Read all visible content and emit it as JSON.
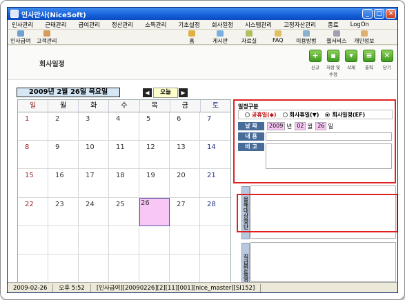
{
  "window": {
    "title": "인사만사(NiceSoft)"
  },
  "menu": [
    "인사관리",
    "근태관리",
    "급여관리",
    "정산관리",
    "소득관리",
    "기초설정",
    "회사일정",
    "시스템관리",
    "고정자산관리",
    "종료",
    "LogOn"
  ],
  "toolbar": {
    "left": [
      "인사급여",
      "고객관리"
    ],
    "right": [
      "홈",
      "게시판",
      "자료실",
      "FAQ",
      "이용방법",
      "웹서비스",
      "개인정보"
    ]
  },
  "page": {
    "title": "회사일정"
  },
  "actions": {
    "new": "신규",
    "save": "저장 및 수정",
    "delete": "삭제",
    "print": "출력",
    "close": "닫기"
  },
  "datebar": {
    "text": "2009년 2월 26일 목요일",
    "today_label": "오늘"
  },
  "calendar": {
    "weekdays": [
      "일",
      "월",
      "화",
      "수",
      "목",
      "금",
      "토"
    ],
    "weeks": [
      [
        "1",
        "2",
        "3",
        "4",
        "5",
        "6",
        "7"
      ],
      [
        "8",
        "9",
        "10",
        "11",
        "12",
        "13",
        "14"
      ],
      [
        "15",
        "16",
        "17",
        "18",
        "19",
        "20",
        "21"
      ],
      [
        "22",
        "23",
        "24",
        "25",
        "26",
        "27",
        "28"
      ],
      [
        "",
        "",
        "",
        "",
        "",
        "",
        ""
      ],
      [
        "",
        "",
        "",
        "",
        "",
        "",
        ""
      ]
    ],
    "selected": "26"
  },
  "schedule": {
    "type_title": "일정구분",
    "radios": [
      {
        "label": "공휴일(◆)",
        "checked": false
      },
      {
        "label": "회사휴일(▼)",
        "checked": false
      },
      {
        "label": "회사일정(EF)",
        "checked": true
      }
    ],
    "labels": {
      "date": "날 짜",
      "content": "내 용",
      "note": "비 고"
    },
    "date": {
      "year": "2009",
      "year_unit": "년",
      "month": "02",
      "month_unit": "월",
      "day": "26",
      "day_unit": "일"
    }
  },
  "panels": {
    "this_month": "올해대상명단",
    "birthday": "직급변동명단"
  },
  "status": [
    "2009-02-26",
    "오후 5:52",
    "[인사급여][20090226][2][11][001][nice_master][SI152]"
  ],
  "colors": {
    "title_bar": "#1560d8",
    "highlight_red": "#e02020",
    "today_cell": "#f9c7f5",
    "label_bg": "#486c9a"
  }
}
